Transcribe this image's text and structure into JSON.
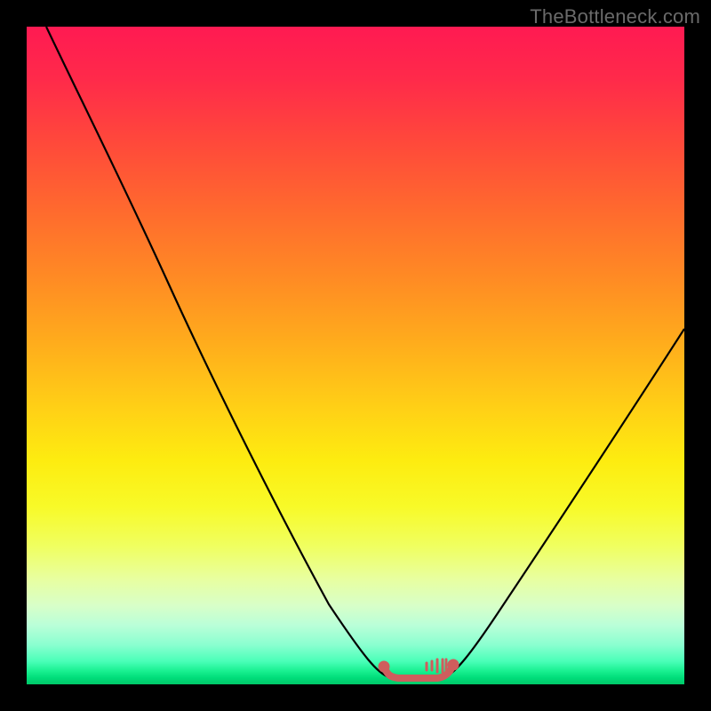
{
  "watermark": "TheBottleneck.com",
  "chart_data": {
    "type": "line",
    "title": "",
    "xlabel": "",
    "ylabel": "",
    "xlim": [
      0,
      100
    ],
    "ylim": [
      0,
      100
    ],
    "series": [
      {
        "name": "bottleneck-curve",
        "x": [
          3,
          10,
          20,
          30,
          40,
          48,
          54,
          56,
          58,
          60,
          62,
          64,
          70,
          80,
          90,
          100
        ],
        "y": [
          100,
          86,
          68,
          51,
          34,
          18,
          4,
          1,
          0.5,
          0.5,
          1,
          3,
          11,
          25,
          40,
          55
        ]
      },
      {
        "name": "optimal-range-marker",
        "x": [
          54,
          55,
          56,
          57,
          58,
          59,
          60,
          61,
          62,
          63,
          64
        ],
        "y": [
          2,
          1.5,
          1.2,
          1,
          1,
          1,
          1,
          1.2,
          1.6,
          2.2,
          3
        ]
      }
    ],
    "background_gradient": {
      "top": "#ff1a52",
      "mid": "#ffd016",
      "bottom": "#00c868"
    },
    "marker_color": "#cf5d5d"
  }
}
